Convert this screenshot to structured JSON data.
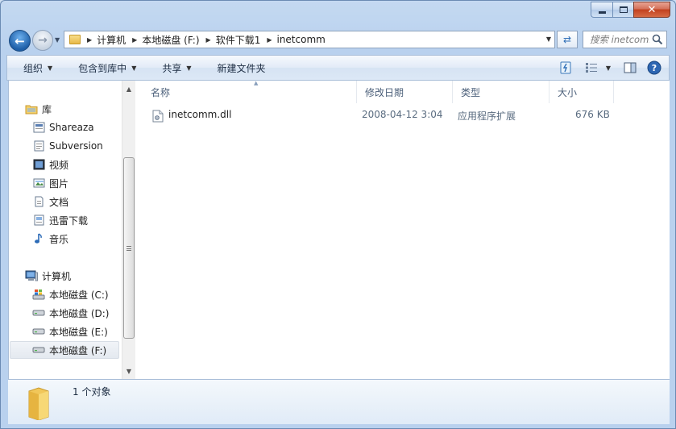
{
  "window": {
    "close_label": "✕"
  },
  "address": {
    "breadcrumbs": [
      "计算机",
      "本地磁盘 (F:)",
      "软件下载1",
      "inetcomm"
    ]
  },
  "search": {
    "placeholder": "搜索 inetcomm"
  },
  "toolbar": {
    "organize": "组织",
    "include_library": "包含到库中",
    "share": "共享",
    "new_folder": "新建文件夹"
  },
  "nav": {
    "library": "库",
    "libraries": [
      "Shareaza",
      "Subversion",
      "视频",
      "图片",
      "文档",
      "迅雷下载",
      "音乐"
    ],
    "computer": "计算机",
    "drives": [
      "本地磁盘 (C:)",
      "本地磁盘 (D:)",
      "本地磁盘 (E:)",
      "本地磁盘 (F:)"
    ],
    "selected_drive": "本地磁盘 (F:)"
  },
  "columns": {
    "name": "名称",
    "modified": "修改日期",
    "type": "类型",
    "size": "大小"
  },
  "files": [
    {
      "name": "inetcomm.dll",
      "modified": "2008-04-12 3:04",
      "type": "应用程序扩展",
      "size": "676 KB"
    }
  ],
  "status": {
    "count": "1 个对象"
  },
  "colors": {
    "accent": "#1e5fa8",
    "frame": "#b9d1ee",
    "close": "#c2411f"
  }
}
